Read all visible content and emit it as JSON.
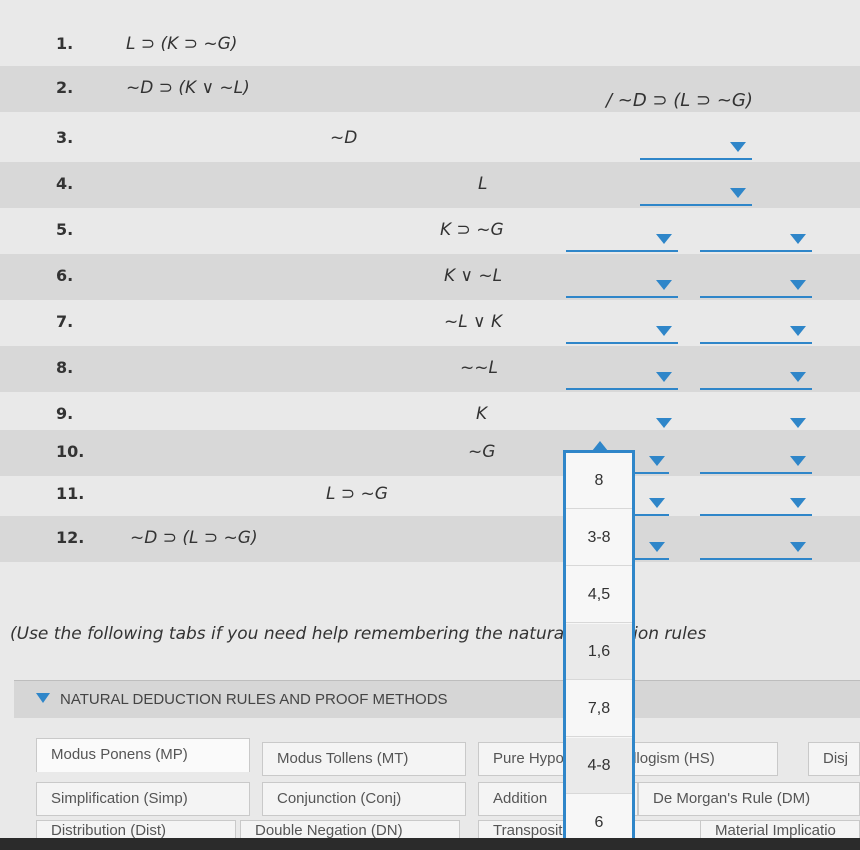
{
  "premises_and_steps": [
    {
      "num": "1.",
      "formula": "L ⊃ (K ⊃ ~G)"
    },
    {
      "num": "2.",
      "formula": "~D ⊃ (K ∨ ~L)"
    },
    {
      "num": "3.",
      "formula": "~D"
    },
    {
      "num": "4.",
      "formula": "L"
    },
    {
      "num": "5.",
      "formula": "K ⊃ ~G"
    },
    {
      "num": "6.",
      "formula": "K ∨ ~L"
    },
    {
      "num": "7.",
      "formula": "~L ∨ K"
    },
    {
      "num": "8.",
      "formula": "~~L"
    },
    {
      "num": "9.",
      "formula": "K"
    },
    {
      "num": "10.",
      "formula": "~G"
    },
    {
      "num": "11.",
      "formula": "L ⊃ ~G"
    },
    {
      "num": "12.",
      "formula": "~D ⊃ (L ⊃ ~G)"
    }
  ],
  "conclusion": "/ ~D ⊃ (L ⊃ ~G)",
  "dropdown_popup": {
    "options": [
      "8",
      "3-8",
      "4,5",
      "1,6",
      "7,8",
      "4-8",
      "6"
    ]
  },
  "help_text": "(Use the following tabs if you need help remembering the natural deduction rules",
  "rules_panel": {
    "title": "NATURAL DEDUCTION RULES AND PROOF METHODS",
    "tabs_row1": [
      "Modus Ponens (MP)",
      "Modus Tollens (MT)",
      "Pure Hypothetical Syllogism (HS)",
      "Disj"
    ],
    "tabs_row2": [
      "Simplification (Simp)",
      "Conjunction (Conj)",
      "Addition",
      "De Morgan's Rule (DM)"
    ],
    "tabs_row3": [
      "Distribution (Dist)",
      "Double Negation (DN)",
      "Transposition (Trans)",
      "Material Implicatio"
    ]
  },
  "colors": {
    "accent": "#2f86c9",
    "row_shade": "#d8d8d8",
    "background": "#e9e9e9"
  }
}
